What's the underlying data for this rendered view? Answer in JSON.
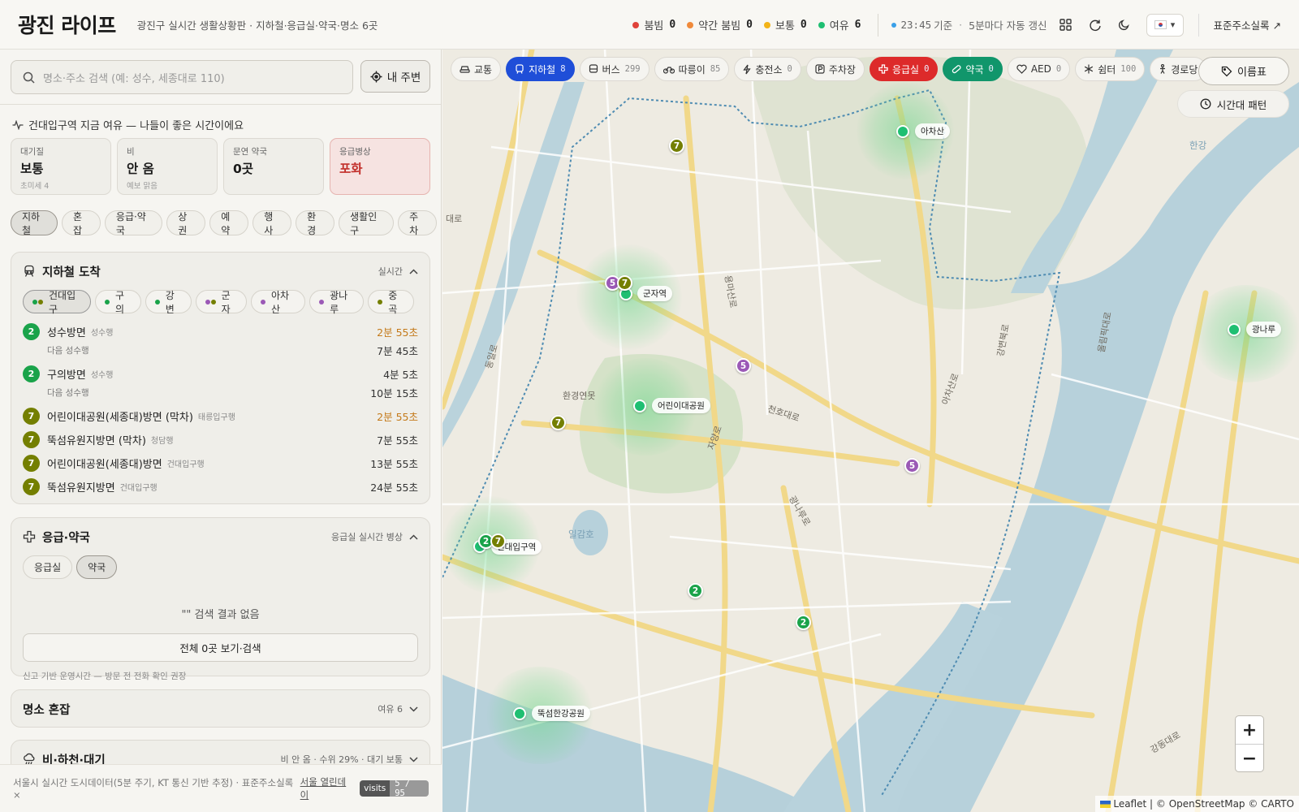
{
  "header": {
    "title": "광진 라이프",
    "subtitle": "광진구 실시간 생활상황판 · 지하철·응급실·약국·명소 6곳",
    "legend": [
      {
        "label": "붐빔",
        "count": "0",
        "color": "#e0433a"
      },
      {
        "label": "약간 붐빔",
        "count": "0",
        "color": "#f08a3a"
      },
      {
        "label": "보통",
        "count": "0",
        "color": "#f2b318"
      },
      {
        "label": "여유",
        "count": "6",
        "color": "#1fbf72"
      }
    ],
    "time": "23:45",
    "time_suffix": "기준",
    "refresh_note": "5분마다 자동 갱신",
    "address_link": "표준주소실록 ↗"
  },
  "sidebar": {
    "search_placeholder": "명소·주소 검색 (예: 성수, 세종대로 110)",
    "near_button": "내 주변",
    "status_message": "건대입구역 지금 여유 — 나들이 좋은 시간이에요",
    "cards": [
      {
        "label": "대기질",
        "value": "보통",
        "sub": "초미세 4"
      },
      {
        "label": "비",
        "value": "안 옴",
        "sub": "예보 맑음"
      },
      {
        "label": "문연 약국",
        "value": "0곳",
        "sub": ""
      },
      {
        "label": "응급병상",
        "value": "포화",
        "sub": ""
      }
    ],
    "chips": [
      "지하철",
      "혼잡",
      "응급·약국",
      "상권",
      "예약",
      "행사",
      "환경",
      "생활인구",
      "주차"
    ],
    "subway": {
      "title": "지하철 도착",
      "right_label": "실시간",
      "stations": [
        "건대입구",
        "구의",
        "강변",
        "군자",
        "아차산",
        "광나루",
        "중곡"
      ],
      "arrivals": [
        {
          "line": "2",
          "dest": "성수방면",
          "via": "성수행",
          "time": "2분 55초",
          "sub": "다음 성수행",
          "sub_time": "7분 45초"
        },
        {
          "line": "2",
          "dest": "구의방면",
          "via": "성수행",
          "time": "4분 5초",
          "sub": "다음 성수행",
          "sub_time": "10분 15초"
        },
        {
          "line": "7",
          "dest": "어린이대공원(세종대)방면 (막차)",
          "via": "태릉입구행",
          "time": "2분 55초"
        },
        {
          "line": "7",
          "dest": "뚝섬유원지방면 (막차)",
          "via": "청담행",
          "time": "7분 55초"
        },
        {
          "line": "7",
          "dest": "어린이대공원(세종대)방면",
          "via": "건대입구행",
          "time": "13분 55초"
        },
        {
          "line": "7",
          "dest": "뚝섬유원지방면",
          "via": "건대입구행",
          "time": "24분 55초"
        }
      ]
    },
    "emergency": {
      "title": "응급·약국",
      "right_label": "응급실 실시간 병상",
      "tabs": [
        "응급실",
        "약국"
      ],
      "empty_message": "\"\" 검색 결과 없음",
      "all_button": "전체 0곳 보기·검색",
      "note": "신고 기반 운영시간 — 방문 전 전화 확인 권장"
    },
    "crowd": {
      "title": "명소 혼잡",
      "right_label": "여유 6"
    },
    "weather": {
      "title": "비·하천·대기",
      "right_label": "비 안 옴 · 수위 29% · 대기 보통"
    },
    "footer": {
      "source": "서울시 실시간 도시데이터(5분 주기, KT 통신 기반 추정) · 표준주소실록 ×",
      "link": "서울 열린데이",
      "visits_label": "visits",
      "visits_value": "5 / 95"
    }
  },
  "map": {
    "toolbar": [
      {
        "label": "교통",
        "count": "",
        "style": ""
      },
      {
        "label": "지하철",
        "count": "8",
        "style": "blue"
      },
      {
        "label": "버스",
        "count": "299",
        "style": ""
      },
      {
        "label": "따릉이",
        "count": "85",
        "style": ""
      },
      {
        "label": "충전소",
        "count": "0",
        "style": ""
      },
      {
        "label": "주차장",
        "count": "",
        "style": ""
      },
      {
        "label": "응급실",
        "count": "0",
        "style": "red"
      },
      {
        "label": "약국",
        "count": "0",
        "style": "green"
      },
      {
        "label": "AED",
        "count": "0",
        "style": ""
      },
      {
        "label": "쉼터",
        "count": "100",
        "style": ""
      },
      {
        "label": "경로당",
        "count": "",
        "style": ""
      }
    ],
    "name_button": "이름표",
    "time_pattern_button": "시간대 패턴",
    "places": [
      "아차산",
      "군자역",
      "어린이대공원",
      "건대입구역",
      "뚝섬한강공원",
      "광나루"
    ],
    "map_labels": [
      "환경연못",
      "일감호",
      "한강",
      "천호대로",
      "광나루로",
      "자양로",
      "용마산로",
      "강변북로",
      "아차산로",
      "동일로",
      "올림픽대로",
      "강동대로",
      "대로"
    ],
    "attribution": {
      "leaflet": "Leaflet",
      "rest": "| © OpenStreetMap © CARTO"
    },
    "zoom_in": "+",
    "zoom_out": "−"
  },
  "colors": {
    "line2": "#1aa34a",
    "line7": "#747f00",
    "line5": "#9b59b6",
    "accent_blue": "#1f4ed8"
  }
}
